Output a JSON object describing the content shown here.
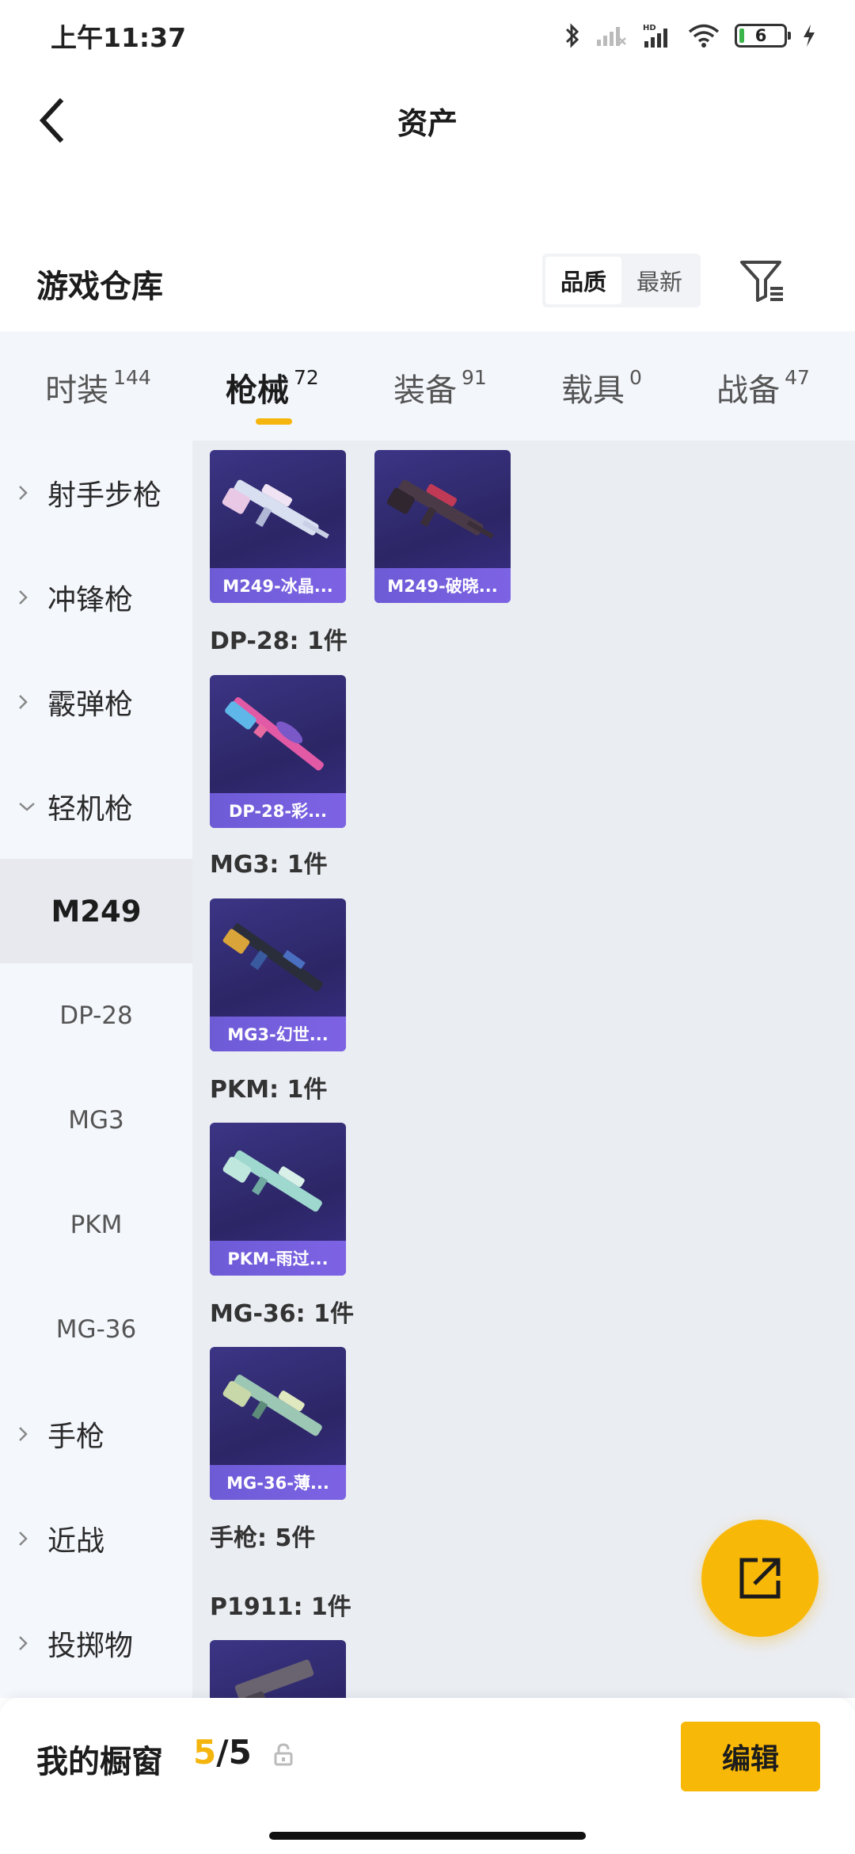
{
  "status_bar": {
    "time": "上午11:37",
    "battery": "6",
    "icons": [
      "bluetooth-icon",
      "signal-icon",
      "hd-signal-icon",
      "wifi-icon",
      "battery-icon",
      "charging-icon"
    ]
  },
  "header": {
    "title": "资产",
    "back_icon": "back-chevron-icon"
  },
  "warehouse": {
    "title": "游戏仓库",
    "sort_options": [
      "品质",
      "最新"
    ],
    "sort_selected": "品质",
    "filter_icon": "filter-icon"
  },
  "tabs": [
    {
      "label": "时装",
      "count": "144"
    },
    {
      "label": "枪械",
      "count": "72",
      "active": true
    },
    {
      "label": "装备",
      "count": "91"
    },
    {
      "label": "载具",
      "count": "0"
    },
    {
      "label": "战备",
      "count": "47"
    }
  ],
  "sidebar": {
    "items": [
      {
        "label": "射手步枪",
        "type": "group",
        "expanded": false
      },
      {
        "label": "冲锋枪",
        "type": "group",
        "expanded": false
      },
      {
        "label": "霰弹枪",
        "type": "group",
        "expanded": false
      },
      {
        "label": "轻机枪",
        "type": "group",
        "expanded": true
      },
      {
        "label": "M249",
        "type": "sub",
        "active": true
      },
      {
        "label": "DP-28",
        "type": "sub"
      },
      {
        "label": "MG3",
        "type": "sub"
      },
      {
        "label": "PKM",
        "type": "sub"
      },
      {
        "label": "MG-36",
        "type": "sub"
      },
      {
        "label": "手枪",
        "type": "group",
        "expanded": false
      },
      {
        "label": "近战",
        "type": "group",
        "expanded": false
      },
      {
        "label": "投掷物",
        "type": "group",
        "expanded": false
      }
    ]
  },
  "content": {
    "m249_items": [
      {
        "label": "M249-冰晶...",
        "color": "#d8dff0"
      },
      {
        "label": "M249-破晓...",
        "color": "#4a3a48"
      }
    ],
    "dp28_header": "DP-28: 1件",
    "dp28_items": [
      {
        "label": "DP-28-彩...",
        "color": "#e25aa6"
      }
    ],
    "mg3_header": "MG3: 1件",
    "mg3_items": [
      {
        "label": "MG3-幻世...",
        "color": "#2a2d3a"
      }
    ],
    "pkm_header": "PKM: 1件",
    "pkm_items": [
      {
        "label": "PKM-雨过...",
        "color": "#9fd8cf"
      }
    ],
    "mg36_header": "MG-36: 1件",
    "mg36_items": [
      {
        "label": "MG-36-薄...",
        "color": "#9cc7b4"
      }
    ],
    "pistol_header": "手枪: 5件",
    "p1911_header": "P1911: 1件"
  },
  "fab_icon": "share-icon",
  "bottom_bar": {
    "label": "我的橱窗",
    "used": "5",
    "total": "/5",
    "lock_icon": "lock-icon",
    "edit_label": "编辑"
  },
  "colors": {
    "accent": "#f8b808",
    "card_bg": "#2c2666",
    "card_label": "#7060d8"
  }
}
